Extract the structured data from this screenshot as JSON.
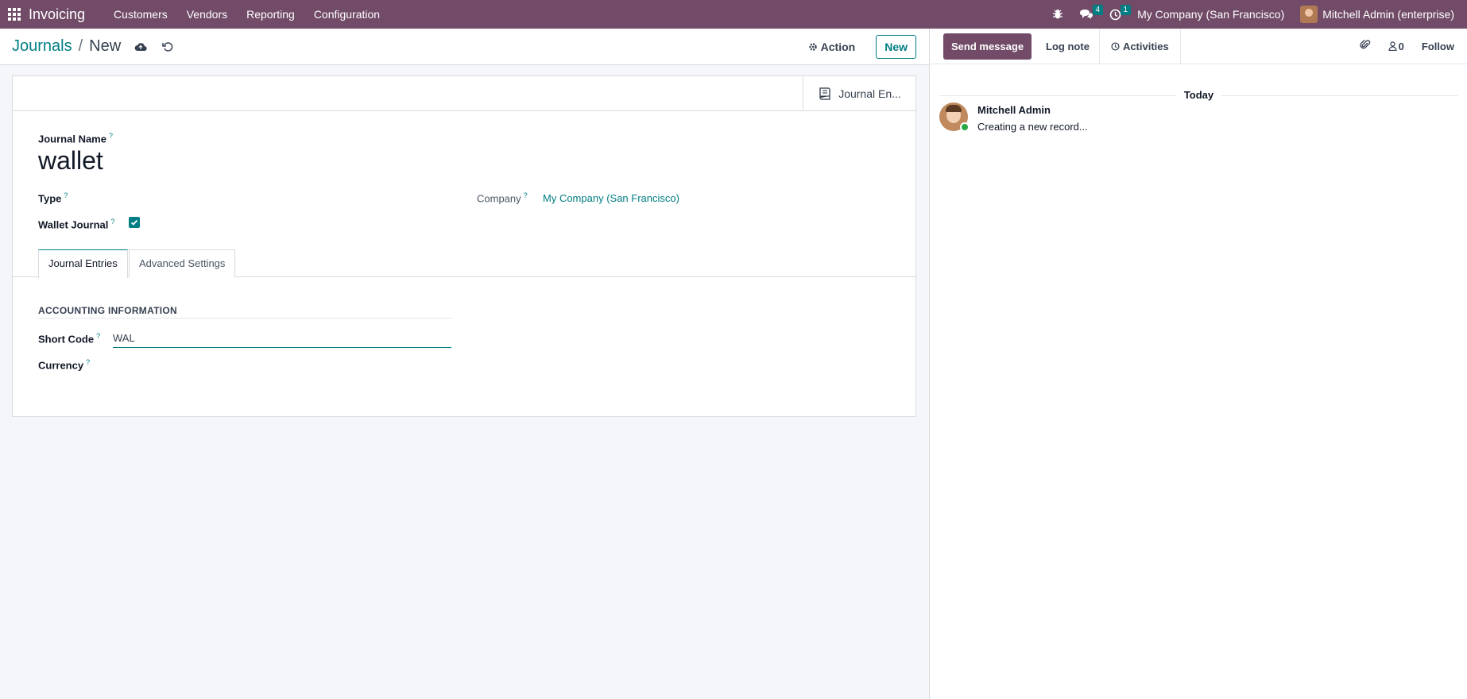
{
  "navbar": {
    "app_name": "Invoicing",
    "menu": [
      "Customers",
      "Vendors",
      "Reporting",
      "Configuration"
    ],
    "messages_count": "4",
    "activities_count": "1",
    "company": "My Company (San Francisco)",
    "user": "Mitchell Admin (enterprise)"
  },
  "breadcrumb": {
    "parent": "Journals",
    "separator": "/",
    "current": "New"
  },
  "control_panel": {
    "action_label": "Action",
    "new_label": "New"
  },
  "form": {
    "smart_button_label": "Journal En...",
    "journal_name_label": "Journal Name",
    "journal_name_value": "wallet",
    "type_label": "Type",
    "wallet_journal_label": "Wallet Journal",
    "wallet_journal_checked": true,
    "company_label": "Company",
    "company_value": "My Company (San Francisco)",
    "tip_mark": "?",
    "tabs": [
      "Journal Entries",
      "Advanced Settings"
    ],
    "section_title": "ACCOUNTING INFORMATION",
    "short_code_label": "Short Code",
    "short_code_value": "WAL",
    "currency_label": "Currency"
  },
  "chatter": {
    "send_message_label": "Send message",
    "log_note_label": "Log note",
    "activities_label": "Activities",
    "followers_count": "0",
    "follow_label": "Follow",
    "date_separator": "Today",
    "messages": [
      {
        "author": "Mitchell Admin",
        "text": "Creating a new record..."
      }
    ]
  },
  "colors": {
    "brand": "#714b67",
    "accent": "#017e84"
  }
}
